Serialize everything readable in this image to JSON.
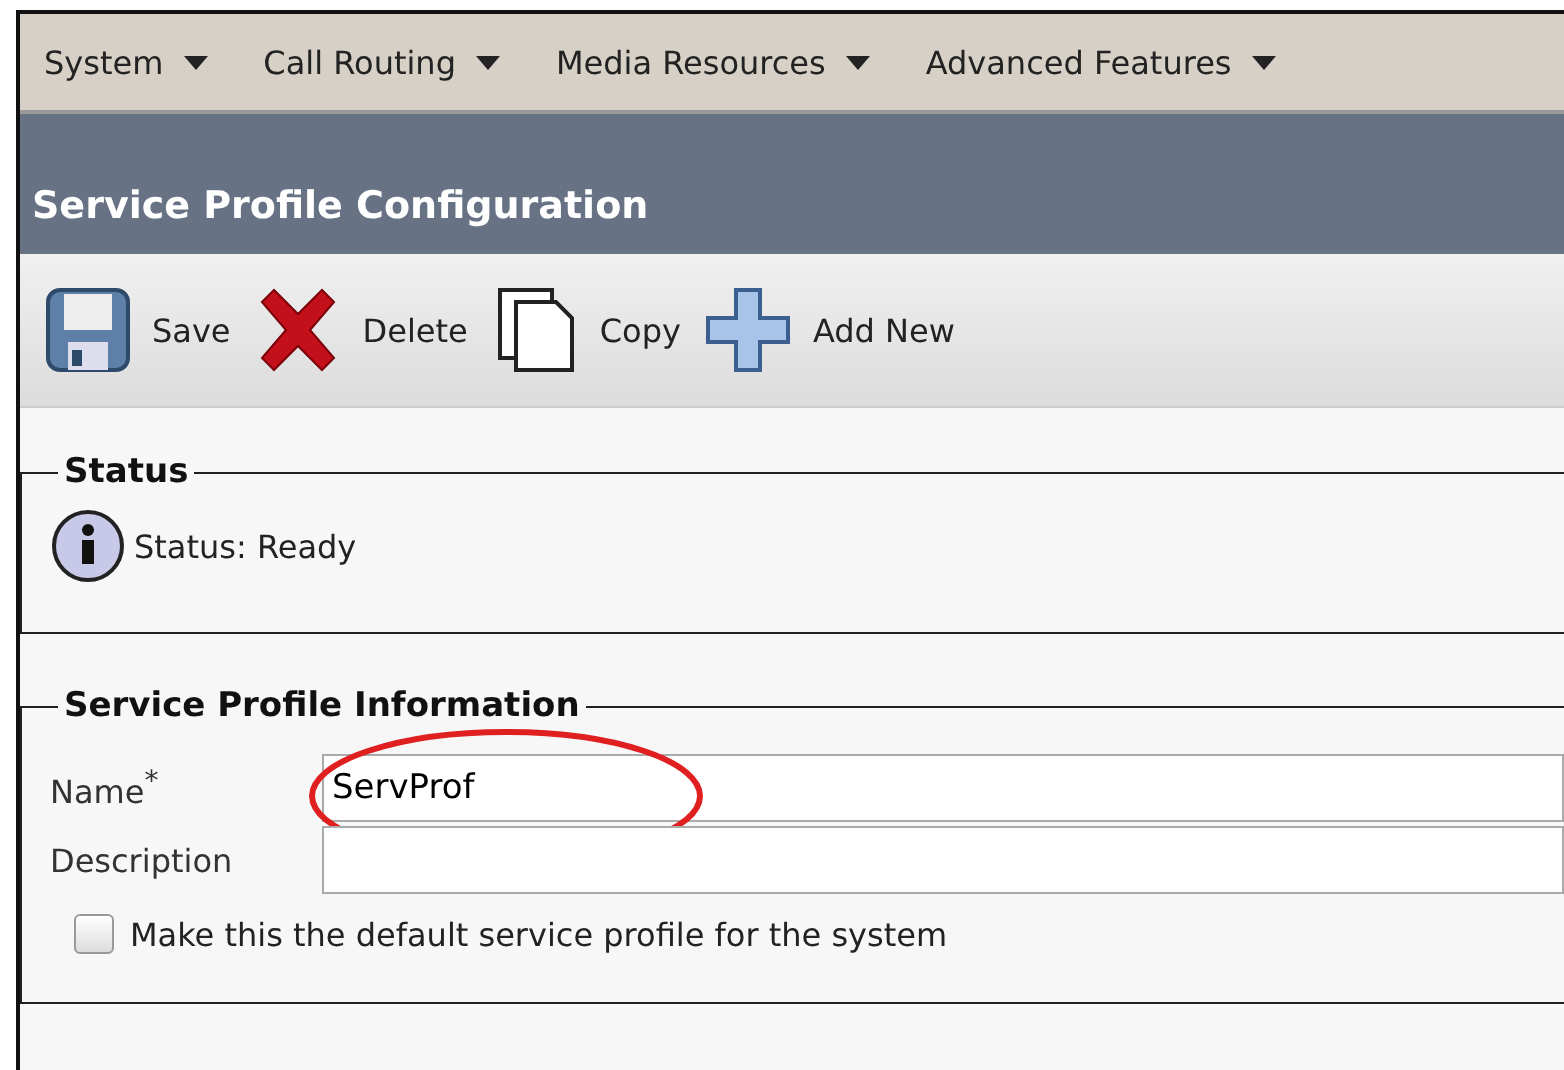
{
  "menu": [
    {
      "label": "System"
    },
    {
      "label": "Call Routing"
    },
    {
      "label": "Media Resources"
    },
    {
      "label": "Advanced Features"
    }
  ],
  "title": "Service Profile Configuration",
  "toolbar": [
    {
      "kind": "save",
      "label": "Save"
    },
    {
      "kind": "delete",
      "label": "Delete"
    },
    {
      "kind": "copy",
      "label": "Copy"
    },
    {
      "kind": "add",
      "label": "Add New"
    }
  ],
  "status": {
    "legend": "Status",
    "message": "Status: Ready"
  },
  "info": {
    "legend": "Service Profile Information",
    "name_label": "Name",
    "required_mark": "*",
    "name_value": "ServProf",
    "description_label": "Description",
    "default_checkbox": {
      "label": "Make this the default service profile for the system",
      "checked": false
    }
  }
}
